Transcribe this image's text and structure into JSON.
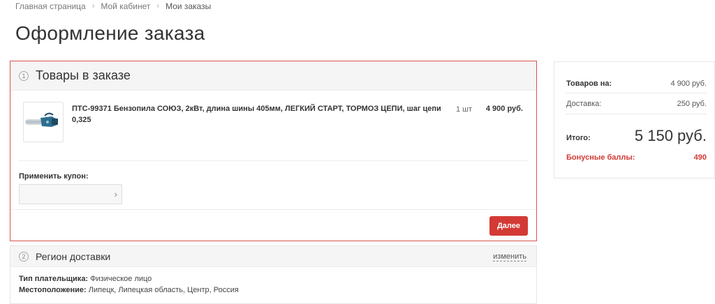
{
  "breadcrumb": {
    "items": [
      "Главная страница",
      "Мой кабинет",
      "Мои заказы"
    ]
  },
  "page": {
    "title": "Оформление заказа"
  },
  "order_section": {
    "step": "1",
    "title": "Товары в заказе",
    "product": {
      "name": "ПТС-99371 Бензопила СОЮЗ, 2кВт, длина шины 405мм, ЛЕГКИЙ СТАРТ, ТОРМОЗ ЦЕПИ, шаг цепи 0,325",
      "qty": "1 шт",
      "price": "4 900 руб."
    },
    "coupon": {
      "label": "Применить купон:",
      "value": "",
      "arrow": "›"
    },
    "next_label": "Далее"
  },
  "region_section": {
    "step": "2",
    "title": "Регион доставки",
    "change_label": "изменить",
    "payer_type_label": "Тип плательщика:",
    "payer_type_value": "Физическое лицо",
    "location_label": "Местоположение:",
    "location_value": "Липецк, Липецкая область, Центр, Россия"
  },
  "summary": {
    "goods_label": "Товаров на:",
    "goods_value": "4 900 руб.",
    "delivery_label": "Доставка:",
    "delivery_value": "250 руб.",
    "total_label": "Итого:",
    "total_value": "5 150 руб.",
    "bonus_label": "Бонусные баллы:",
    "bonus_value": "490"
  },
  "colors": {
    "accent": "#d33a35",
    "panel_bg": "#f5f5f5"
  },
  "icons": {
    "breadcrumb_separator": "chevron-right-icon",
    "step_marker": "circle-number-icon",
    "coupon_submit": "chevron-right-icon",
    "product_image": "chainsaw-thumbnail"
  }
}
